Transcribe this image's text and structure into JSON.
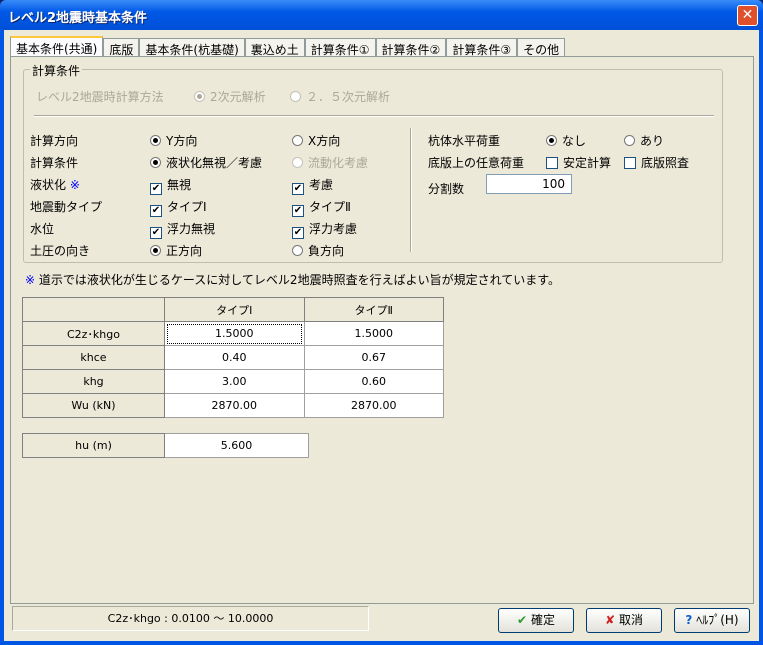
{
  "window": {
    "title": "レベル2地震時基本条件",
    "close": "✕"
  },
  "tabs": [
    "基本条件(共通)",
    "底版",
    "基本条件(杭基礎)",
    "裏込め土",
    "計算条件①",
    "計算条件②",
    "計算条件③",
    "その他"
  ],
  "group": {
    "label": "計算条件",
    "method": {
      "label": "レベル2地震時計算方法",
      "opt1": "2次元解析",
      "opt2": "２．５次元解析"
    },
    "rows": [
      {
        "label": "計算方向",
        "o1": "Y方向",
        "o2": "X方向"
      },
      {
        "label": "計算条件",
        "o1": "液状化無視／考慮",
        "o2": "流動化考慮"
      },
      {
        "label": "液状化",
        "mark": "※",
        "o1": "無視",
        "o2": "考慮"
      },
      {
        "label": "地震動タイプ",
        "o1": "タイプⅠ",
        "o2": "タイプⅡ"
      },
      {
        "label": "水位",
        "o1": "浮力無視",
        "o2": "浮力考慮"
      },
      {
        "label": "土圧の向き",
        "o1": "正方向",
        "o2": "負方向"
      }
    ],
    "right": {
      "pile_label": "杭体水平荷重",
      "pile_o1": "なし",
      "pile_o2": "あり",
      "slab_label": "底版上の任意荷重",
      "slab_c1": "安定計算",
      "slab_c2": "底版照査",
      "div_label": "分割数",
      "div_value": "100"
    }
  },
  "note": {
    "mark": "※",
    "text": "道示では液状化が生じるケースに対してレベル2地震時照査を行えばよい旨が規定されています。"
  },
  "table": {
    "headers": [
      "",
      "タイプⅠ",
      "タイプⅡ"
    ],
    "rows": [
      [
        "C2z･khgo",
        "1.5000",
        "1.5000"
      ],
      [
        "khce",
        "0.40",
        "0.67"
      ],
      [
        "khg",
        "3.00",
        "0.60"
      ],
      [
        "Wu (kN)",
        "2870.00",
        "2870.00"
      ]
    ]
  },
  "hu": {
    "label": "hu (m)",
    "value": "5.600"
  },
  "status": "C2z･khgo : 0.0100 ～ 10.0000",
  "buttons": {
    "ok": "確定",
    "cancel": "取消",
    "help": "ﾍﾙﾌﾟ(H)"
  }
}
